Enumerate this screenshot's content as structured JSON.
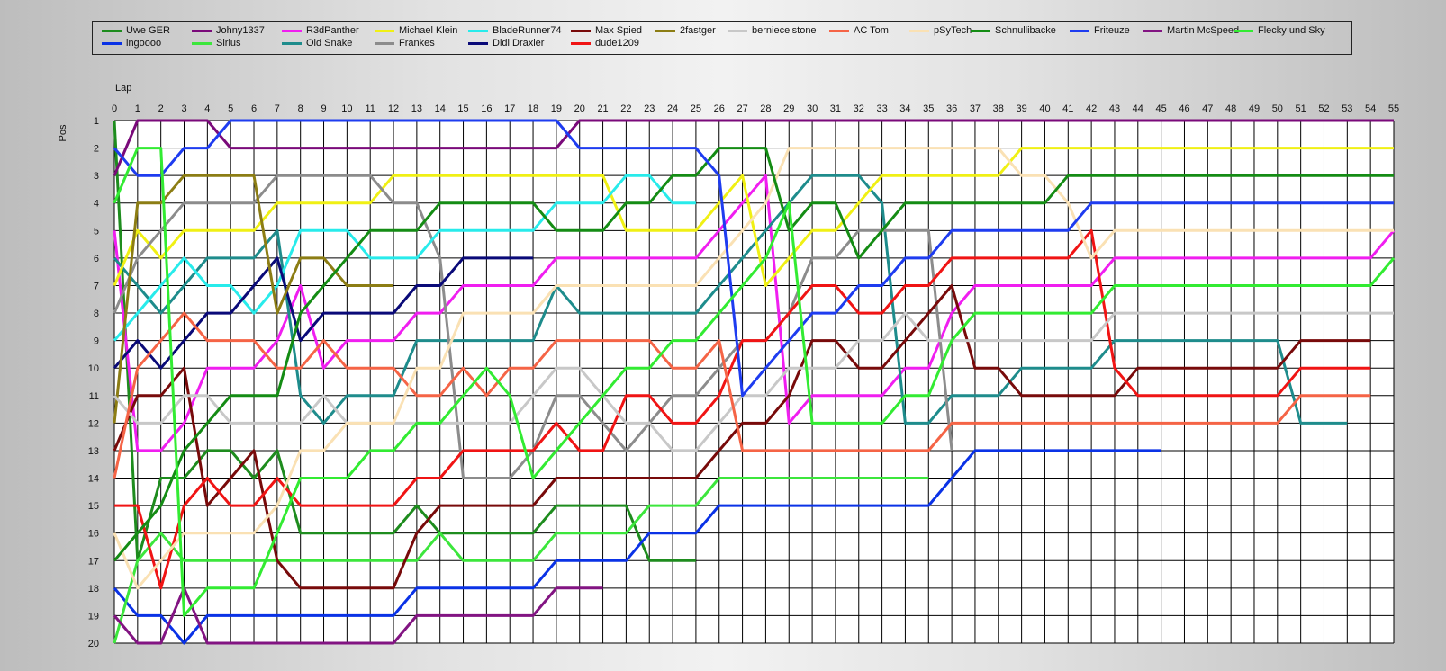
{
  "chart_data": {
    "type": "line",
    "xlabel": "Lap",
    "ylabel": "Pos",
    "xlim": [
      0,
      55
    ],
    "ylim": [
      1,
      20
    ],
    "x_ticks": [
      "0",
      "1",
      "2",
      "3",
      "4",
      "5",
      "6",
      "7",
      "8",
      "9",
      "10",
      "11",
      "12",
      "13",
      "14",
      "15",
      "16",
      "17",
      "18",
      "19",
      "20",
      "21",
      "22",
      "23",
      "24",
      "25",
      "26",
      "27",
      "28",
      "29",
      "30",
      "31",
      "32",
      "33",
      "34",
      "35",
      "36",
      "37",
      "38",
      "39",
      "40",
      "41",
      "42",
      "43",
      "44",
      "45",
      "46",
      "47",
      "48",
      "49",
      "50",
      "51",
      "52",
      "53",
      "54",
      "55"
    ],
    "y_ticks": [
      "1",
      "2",
      "3",
      "4",
      "5",
      "6",
      "7",
      "8",
      "9",
      "10",
      "11",
      "12",
      "13",
      "14",
      "15",
      "16",
      "17",
      "18",
      "19",
      "20"
    ],
    "grid": true,
    "legend_position": "top",
    "series": [
      {
        "name": "Uwe GER",
        "color": "#1e8c1e",
        "values": [
          1,
          17,
          14,
          14,
          13,
          13,
          14,
          13,
          16,
          16,
          16,
          16,
          16,
          15,
          16,
          16,
          16,
          16,
          16,
          15,
          15,
          15,
          15,
          17,
          17,
          17
        ]
      },
      {
        "name": "ingoooo",
        "color": "#0a32e6",
        "values": [
          18,
          19,
          19,
          20,
          19,
          19,
          19,
          19,
          19,
          19,
          19,
          19,
          19,
          18,
          18,
          18,
          18,
          18,
          18,
          17,
          17,
          17,
          17,
          16,
          16,
          16,
          15,
          15,
          15,
          15,
          15,
          15,
          15,
          15,
          15,
          15,
          14,
          13,
          13,
          13,
          13,
          13,
          13,
          13,
          13,
          13
        ]
      },
      {
        "name": "Johny1337",
        "color": "#7a0a7a",
        "values": [
          3,
          1,
          1,
          1,
          1,
          2,
          2,
          2,
          2,
          2,
          2,
          2,
          2,
          2,
          2,
          2,
          2,
          2,
          2,
          2,
          1,
          1,
          1,
          1,
          1,
          1,
          1,
          1,
          1,
          1,
          1,
          1,
          1,
          1,
          1,
          1,
          1,
          1,
          1,
          1,
          1,
          1,
          1,
          1,
          1,
          1,
          1,
          1,
          1,
          1,
          1,
          1,
          1,
          1,
          1,
          1
        ]
      },
      {
        "name": "Sirius",
        "color": "#3ce63c",
        "values": [
          20,
          17,
          16,
          17,
          17,
          17,
          17,
          17,
          17,
          17,
          17,
          17,
          17,
          17,
          16,
          17,
          17,
          17,
          17,
          16,
          16,
          16,
          16,
          15,
          15,
          15,
          14,
          14,
          14,
          14,
          14,
          14,
          14,
          14,
          14,
          14
        ]
      },
      {
        "name": "R3dPanther",
        "color": "#f01ef0",
        "values": [
          5,
          13,
          13,
          12,
          10,
          10,
          10,
          9,
          7,
          10,
          9,
          9,
          9,
          8,
          8,
          7,
          7,
          7,
          7,
          6,
          6,
          6,
          6,
          6,
          6,
          6,
          5,
          4,
          3,
          12,
          11,
          11,
          11,
          11,
          10,
          10,
          8,
          7,
          7,
          7,
          7,
          7,
          7,
          6,
          6,
          6,
          6,
          6,
          6,
          6,
          6,
          6,
          6,
          6,
          6,
          5
        ]
      },
      {
        "name": "Old Snake",
        "color": "#1e8c8c",
        "values": [
          6,
          7,
          8,
          7,
          6,
          6,
          6,
          5,
          11,
          12,
          11,
          11,
          11,
          9,
          9,
          9,
          9,
          9,
          9,
          7,
          8,
          8,
          8,
          8,
          8,
          8,
          7,
          6,
          5,
          4,
          3,
          3,
          3,
          4,
          12,
          12,
          11,
          11,
          11,
          10,
          10,
          10,
          10,
          9,
          9,
          9,
          9,
          9,
          9,
          9,
          9,
          12,
          12,
          12
        ]
      },
      {
        "name": "Michael Klein",
        "color": "#f0f014",
        "values": [
          7,
          5,
          6,
          5,
          5,
          5,
          5,
          4,
          4,
          4,
          4,
          4,
          3,
          3,
          3,
          3,
          3,
          3,
          3,
          3,
          3,
          3,
          5,
          5,
          5,
          5,
          4,
          3,
          7,
          6,
          5,
          5,
          4,
          3,
          3,
          3,
          3,
          3,
          3,
          2,
          2,
          2,
          2,
          2,
          2,
          2,
          2,
          2,
          2,
          2,
          2,
          2,
          2,
          2,
          2,
          2
        ]
      },
      {
        "name": "Frankes",
        "color": "#8c8c8c",
        "values": [
          8,
          6,
          5,
          4,
          4,
          4,
          4,
          3,
          3,
          3,
          3,
          3,
          4,
          4,
          6,
          14,
          14,
          14,
          13,
          11,
          11,
          12,
          13,
          12,
          11,
          11,
          10,
          9,
          9,
          8,
          6,
          6,
          5,
          5,
          5,
          5,
          13
        ]
      },
      {
        "name": "BladeRunner74",
        "color": "#28ebeb",
        "values": [
          9,
          8,
          7,
          6,
          7,
          7,
          8,
          7,
          5,
          5,
          5,
          6,
          6,
          6,
          5,
          5,
          5,
          5,
          5,
          4,
          4,
          4,
          3,
          3,
          4,
          4
        ]
      },
      {
        "name": "Didi Draxler",
        "color": "#0a0a78",
        "values": [
          10,
          9,
          10,
          9,
          8,
          8,
          7,
          6,
          9,
          8,
          8,
          8,
          8,
          7,
          7,
          6,
          6,
          6,
          6
        ]
      },
      {
        "name": "Max Spied",
        "color": "#780a0a",
        "values": [
          13,
          11,
          11,
          10,
          15,
          14,
          13,
          17,
          18,
          18,
          18,
          18,
          18,
          16,
          15,
          15,
          15,
          15,
          15,
          14,
          14,
          14,
          14,
          14,
          14,
          14,
          13,
          12,
          12,
          11,
          9,
          9,
          10,
          10,
          9,
          8,
          7,
          10,
          10,
          11,
          11,
          11,
          11,
          11,
          10,
          10,
          10,
          10,
          10,
          10,
          10,
          9,
          9,
          9,
          9
        ]
      },
      {
        "name": "dude1209",
        "color": "#f01414",
        "values": [
          15,
          15,
          18,
          15,
          14,
          15,
          15,
          14,
          15,
          15,
          15,
          15,
          15,
          14,
          14,
          13,
          13,
          13,
          13,
          12,
          13,
          13,
          11,
          11,
          12,
          12,
          11,
          9,
          9,
          8,
          7,
          7,
          8,
          8,
          7,
          7,
          6,
          6,
          6,
          6,
          6,
          6,
          5,
          10,
          11,
          11,
          11,
          11,
          11,
          11,
          11,
          10,
          10,
          10,
          10
        ]
      },
      {
        "name": "2fastger",
        "color": "#8c7d14",
        "values": [
          12,
          4,
          4,
          3,
          3,
          3,
          3,
          8,
          6,
          6,
          7,
          7,
          7
        ]
      },
      {
        "name": "berniecelstone",
        "color": "#c8c8c8",
        "values": [
          11,
          12,
          12,
          11,
          11,
          12,
          12,
          12,
          12,
          11,
          12,
          12,
          12,
          12,
          12,
          12,
          12,
          12,
          11,
          10,
          10,
          11,
          12,
          12,
          13,
          13,
          12,
          11,
          11,
          10,
          10,
          10,
          9,
          9,
          8,
          9,
          9,
          9,
          9,
          9,
          9,
          9,
          9,
          8,
          8,
          8,
          8,
          8,
          8,
          8,
          8,
          8,
          8,
          8,
          8,
          8
        ]
      },
      {
        "name": "AC Tom",
        "color": "#f56446",
        "values": [
          14,
          10,
          9,
          8,
          9,
          9,
          9,
          10,
          10,
          9,
          10,
          10,
          10,
          11,
          11,
          10,
          11,
          10,
          10,
          9,
          9,
          9,
          9,
          9,
          10,
          10,
          9,
          13,
          13,
          13,
          13,
          13,
          13,
          13,
          13,
          13,
          12,
          12,
          12,
          12,
          12,
          12,
          12,
          12,
          12,
          12,
          12,
          12,
          12,
          12,
          12,
          11,
          11,
          11,
          11
        ]
      },
      {
        "name": "pSyTech",
        "color": "#fae1b4",
        "values": [
          16,
          18,
          17,
          16,
          16,
          16,
          16,
          15,
          13,
          13,
          12,
          12,
          12,
          10,
          10,
          8,
          8,
          8,
          8,
          7,
          7,
          7,
          7,
          7,
          7,
          7,
          6,
          5,
          4,
          2,
          2,
          2,
          2,
          2,
          2,
          2,
          2,
          2,
          2,
          3,
          3,
          4,
          6,
          5,
          5,
          5,
          5,
          5,
          5,
          5,
          5,
          5,
          5,
          5,
          5,
          5
        ]
      },
      {
        "name": "Schnullibacke",
        "color": "#148c14",
        "values": [
          17,
          16,
          15,
          13,
          12,
          11,
          11,
          11,
          8,
          7,
          6,
          5,
          5,
          5,
          4,
          4,
          4,
          4,
          4,
          5,
          5,
          5,
          4,
          4,
          3,
          3,
          2,
          2,
          2,
          5,
          4,
          4,
          6,
          5,
          4,
          4,
          4,
          4,
          4,
          4,
          4,
          3,
          3,
          3,
          3,
          3,
          3,
          3,
          3,
          3,
          3,
          3,
          3,
          3,
          3,
          3
        ]
      },
      {
        "name": "Friteuze",
        "color": "#1e3cf0",
        "values": [
          2,
          3,
          3,
          2,
          2,
          1,
          1,
          1,
          1,
          1,
          1,
          1,
          1,
          1,
          1,
          1,
          1,
          1,
          1,
          1,
          2,
          2,
          2,
          2,
          2,
          2,
          3,
          11,
          10,
          9,
          8,
          8,
          7,
          7,
          6,
          6,
          5,
          5,
          5,
          5,
          5,
          5,
          4,
          4,
          4,
          4,
          4,
          4,
          4,
          4,
          4,
          4,
          4,
          4,
          4,
          4
        ]
      },
      {
        "name": "Martin McSpeed",
        "color": "#821482",
        "values": [
          19,
          20,
          20,
          18,
          20,
          20,
          20,
          20,
          20,
          20,
          20,
          20,
          20,
          19,
          19,
          19,
          19,
          19,
          19,
          18,
          18,
          18
        ]
      },
      {
        "name": "Flecky und Sky",
        "color": "#32eb32",
        "values": [
          4,
          2,
          2,
          19,
          18,
          18,
          18,
          16,
          14,
          14,
          14,
          13,
          13,
          12,
          12,
          11,
          10,
          11,
          14,
          13,
          12,
          11,
          10,
          10,
          9,
          9,
          8,
          7,
          6,
          4,
          12,
          12,
          12,
          12,
          11,
          11,
          9,
          8,
          8,
          8,
          8,
          8,
          8,
          7,
          7,
          7,
          7,
          7,
          7,
          7,
          7,
          7,
          7,
          7,
          7,
          6
        ]
      }
    ]
  }
}
